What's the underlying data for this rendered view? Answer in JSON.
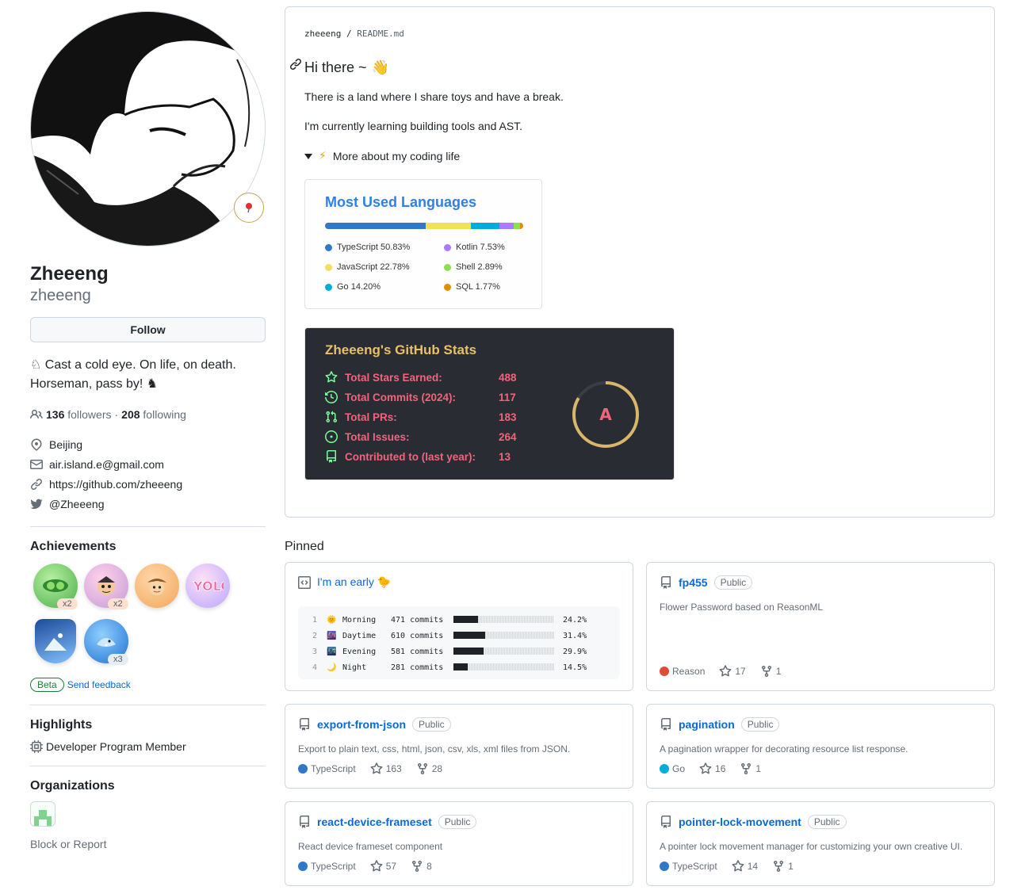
{
  "profile": {
    "name": "Zheeeng",
    "login": "zheeeng",
    "follow_label": "Follow",
    "bio_line1": "♘ Cast a cold eye. On life, on death.",
    "bio_line2": "Horseman, pass by! ♞",
    "followers_count": "136",
    "followers_label": "followers",
    "separator": "·",
    "following_count": "208",
    "following_label": "following",
    "location": "Beijing",
    "email": "air.island.e@gmail.com",
    "website": "https://github.com/zheeeng",
    "twitter": "@Zheeeng"
  },
  "achievements": {
    "title": "Achievements",
    "badges": [
      {
        "icon": "pair-extraordinaire",
        "count": "x2"
      },
      {
        "icon": "quickdraw",
        "count": "x2"
      },
      {
        "icon": "starstruck",
        "count": ""
      },
      {
        "icon": "yolo",
        "count": ""
      },
      {
        "icon": "arctic-code-vault",
        "count": ""
      },
      {
        "icon": "pull-shark",
        "count": "x3"
      }
    ],
    "beta_label": "Beta",
    "feedback_label": "Send feedback"
  },
  "highlights": {
    "title": "Highlights",
    "item": "Developer Program Member"
  },
  "organizations": {
    "title": "Organizations",
    "block_report": "Block or Report"
  },
  "readme": {
    "owner": "zheeeng",
    "sep": "/",
    "file": "README.md",
    "heading": "Hi there ~",
    "wave": "👋",
    "para1": "There is a land where I share toys and have a break.",
    "para2": "I'm currently learning building tools and AST.",
    "summary_icon": "⚡",
    "summary": "More about my coding life"
  },
  "languages": {
    "title": "Most Used Languages",
    "items": [
      {
        "name": "TypeScript",
        "pct": 50.83,
        "label": "TypeScript 50.83%",
        "color": "#3178c6"
      },
      {
        "name": "JavaScript",
        "pct": 22.78,
        "label": "JavaScript 22.78%",
        "color": "#f1e05a"
      },
      {
        "name": "Go",
        "pct": 14.2,
        "label": "Go 14.20%",
        "color": "#00add8"
      },
      {
        "name": "Kotlin",
        "pct": 7.53,
        "label": "Kotlin 7.53%",
        "color": "#a97bff"
      },
      {
        "name": "Shell",
        "pct": 2.89,
        "label": "Shell 2.89%",
        "color": "#89e051"
      },
      {
        "name": "SQL",
        "pct": 1.77,
        "label": "SQL 1.77%",
        "color": "#e38c00"
      }
    ]
  },
  "stats": {
    "title": "Zheeeng's GitHub Stats",
    "rank": "A",
    "rows": [
      {
        "icon": "star-icon",
        "label": "Total Stars Earned:",
        "value": "488"
      },
      {
        "icon": "history-icon",
        "label": "Total Commits (2024):",
        "value": "117"
      },
      {
        "icon": "pr-icon",
        "label": "Total PRs:",
        "value": "183"
      },
      {
        "icon": "issue-icon",
        "label": "Total Issues:",
        "value": "264"
      },
      {
        "icon": "repo-icon",
        "label": "Contributed to (last year):",
        "value": "13"
      }
    ],
    "colors": {
      "title": "#e8c167",
      "text": "#f0647c",
      "bg": "#2a2c33",
      "ring": "#d8b76a"
    }
  },
  "pinned": {
    "title": "Pinned",
    "gist": {
      "title": "I'm an early",
      "emoji": "🐤",
      "rows": [
        {
          "n": "1",
          "emoji": "🌞",
          "period": "Morning",
          "commits": "471 commits",
          "pct_label": "24.2%",
          "pct": 24.2
        },
        {
          "n": "2",
          "emoji": "🌆",
          "period": "Daytime",
          "commits": "610 commits",
          "pct_label": "31.4%",
          "pct": 31.4
        },
        {
          "n": "3",
          "emoji": "🌃",
          "period": "Evening",
          "commits": "581 commits",
          "pct_label": "29.9%",
          "pct": 29.9
        },
        {
          "n": "4",
          "emoji": "🌙",
          "period": "Night",
          "commits": "281 commits",
          "pct_label": "14.5%",
          "pct": 14.5
        }
      ]
    },
    "repos": [
      {
        "name": "fp455",
        "visibility": "Public",
        "desc": "Flower Password based on ReasonML",
        "lang": "Reason",
        "lang_color": "#dd4b39",
        "stars": "17",
        "forks": "1"
      },
      {
        "name": "export-from-json",
        "visibility": "Public",
        "desc": "Export to plain text, css, html, json, csv, xls, xml files from JSON.",
        "lang": "TypeScript",
        "lang_color": "#3178c6",
        "stars": "163",
        "forks": "28"
      },
      {
        "name": "pagination",
        "visibility": "Public",
        "desc": "A pagination wrapper for decorating resource list response.",
        "lang": "Go",
        "lang_color": "#00add8",
        "stars": "16",
        "forks": "1"
      },
      {
        "name": "react-device-frameset",
        "visibility": "Public",
        "desc": "React device frameset component",
        "lang": "TypeScript",
        "lang_color": "#3178c6",
        "stars": "57",
        "forks": "8"
      },
      {
        "name": "pointer-lock-movement",
        "visibility": "Public",
        "desc": "A pointer lock movement manager for customizing your own creative UI.",
        "lang": "TypeScript",
        "lang_color": "#3178c6",
        "stars": "14",
        "forks": "1"
      }
    ]
  }
}
